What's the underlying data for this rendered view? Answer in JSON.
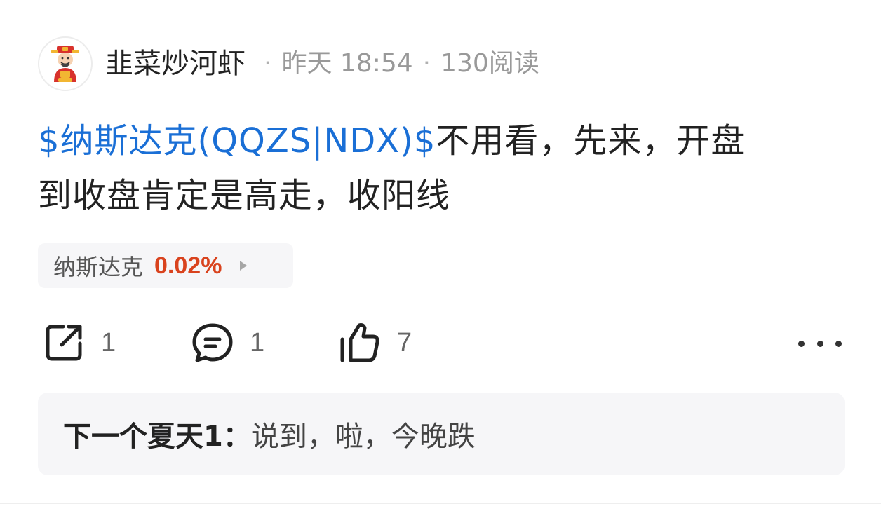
{
  "post": {
    "author": "韭菜炒河虾",
    "separator": "·",
    "time": "昨天 18:54",
    "reads": "130阅读",
    "stock_tag": "$纳斯达克(QQZS|NDX)$",
    "text_line1": "不用看，先来，开盘",
    "text_line2": "到收盘肯定是高走，收阳线"
  },
  "stock_chip": {
    "name": "纳斯达克",
    "change": "0.02%",
    "change_color": "#d9431e"
  },
  "actions": {
    "share_count": "1",
    "comment_count": "1",
    "like_count": "7"
  },
  "comment": {
    "author": "下一个夏天1：",
    "text": "说到，啦，今晚跌"
  },
  "colors": {
    "link": "#1a6fd6",
    "muted": "#999999",
    "card_bg": "#f6f6f8"
  },
  "icons": {
    "avatar": "caishen-avatar-icon",
    "share": "share-icon",
    "comment": "comment-icon",
    "like": "thumbs-up-icon",
    "more": "more-dots-icon",
    "chip_arrow": "chevron-right-icon"
  }
}
